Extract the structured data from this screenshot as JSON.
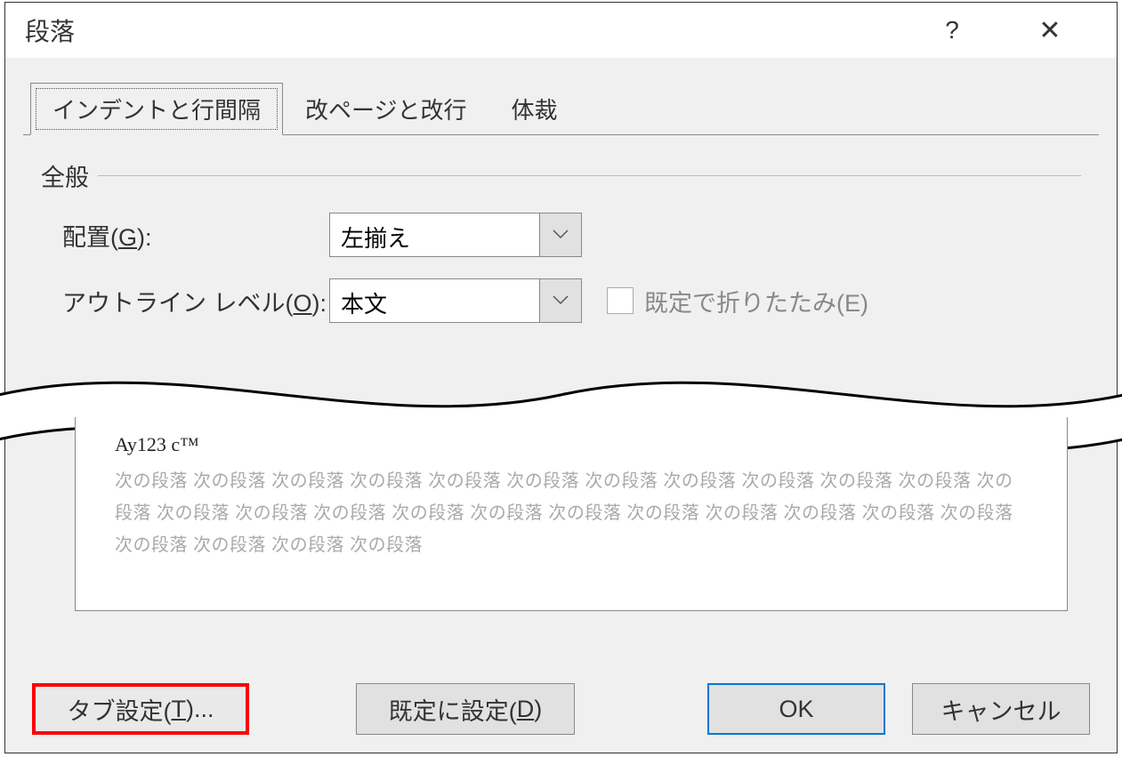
{
  "dialog": {
    "title": "段落",
    "help": "?",
    "close": "✕"
  },
  "tabs": {
    "indent": "インデントと行間隔",
    "page": "改ページと改行",
    "style": "体裁"
  },
  "general": {
    "heading": "全般",
    "alignment_label_pre": "配置(",
    "alignment_key": "G",
    "alignment_label_post": "):",
    "alignment_value": "左揃え",
    "outline_label_pre": "アウトライン レベル(",
    "outline_key": "O",
    "outline_label_post": "):",
    "outline_value": "本文",
    "collapse_label": "既定で折りたたみ(E)"
  },
  "preview": {
    "sample": "Ay123 c™",
    "next": "次の段落 次の段落 次の段落 次の段落 次の段落 次の段落 次の段落 次の段落 次の段落 次の段落 次の段落 次の段落 次の段落 次の段落 次の段落 次の段落 次の段落 次の段落 次の段落 次の段落 次の段落 次の段落 次の段落 次の段落 次の段落 次の段落 次の段落"
  },
  "buttons": {
    "tabs_pre": "タブ設定(",
    "tabs_key": "T",
    "tabs_post": ")...",
    "default_pre": "既定に設定(",
    "default_key": "D",
    "default_post": ")",
    "ok": "OK",
    "cancel": "キャンセル"
  }
}
